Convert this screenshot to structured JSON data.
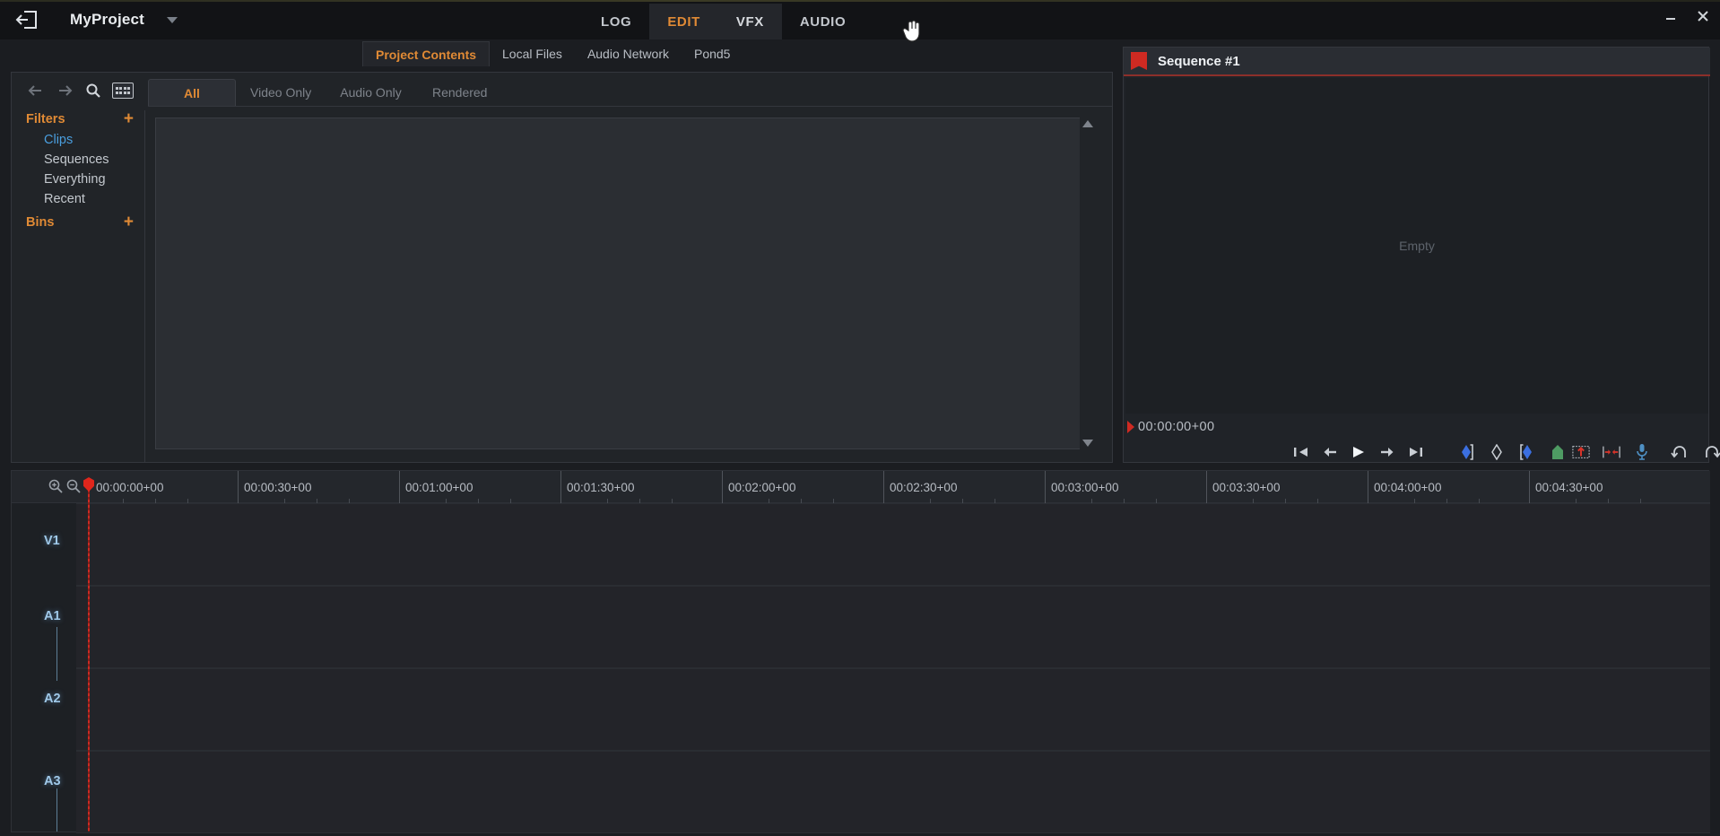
{
  "titlebar": {
    "exit_icon": "exit-icon",
    "project_name": "MyProject",
    "project_caret_icon": "chevron-down-icon",
    "mode_tabs": [
      {
        "label": "LOG",
        "active": false
      },
      {
        "label": "EDIT",
        "active": true
      },
      {
        "label": "VFX",
        "active": false,
        "hovered": true
      },
      {
        "label": "AUDIO",
        "active": false
      }
    ],
    "minimize_icon": "minimize-icon",
    "close_icon": "close-icon"
  },
  "browser": {
    "tabs": [
      {
        "label": "Project Contents",
        "active": true
      },
      {
        "label": "Local Files",
        "active": false
      },
      {
        "label": "Audio Network",
        "active": false
      },
      {
        "label": "Pond5",
        "active": false
      }
    ],
    "toolbar": {
      "back_icon": "back-arrow-icon",
      "forward_icon": "forward-arrow-icon",
      "search_icon": "search-icon",
      "view_toggle_icon": "grid-view-icon"
    },
    "filters": {
      "groups": [
        {
          "label": "Filters",
          "add_label": "+",
          "items": [
            {
              "label": "Clips",
              "selected": true
            },
            {
              "label": "Sequences",
              "selected": false
            },
            {
              "label": "Everything",
              "selected": false
            },
            {
              "label": "Recent",
              "selected": false
            }
          ]
        },
        {
          "label": "Bins",
          "add_label": "+",
          "items": []
        }
      ]
    },
    "content_tabs": [
      {
        "label": "All",
        "active": true
      },
      {
        "label": "Video Only",
        "active": false
      },
      {
        "label": "Audio Only",
        "active": false
      },
      {
        "label": "Rendered",
        "active": false
      }
    ],
    "scroll_up_icon": "scroll-up-arrow-icon",
    "scroll_down_icon": "scroll-down-arrow-icon"
  },
  "viewer": {
    "flag_icon": "sequence-flag-icon",
    "title": "Sequence #1",
    "empty_label": "Empty",
    "timecode": "00:00:00+00",
    "transport": [
      {
        "name": "go-to-start-icon",
        "label": "Go To Start"
      },
      {
        "name": "step-back-icon",
        "label": "Step Back"
      },
      {
        "name": "play-icon",
        "label": "Play"
      },
      {
        "name": "step-forward-icon",
        "label": "Step Forward"
      },
      {
        "name": "go-to-end-icon",
        "label": "Go To End"
      },
      {
        "name": "mark-in-icon",
        "label": "Mark In"
      },
      {
        "name": "mark-clip-icon",
        "label": "Mark Clip"
      },
      {
        "name": "mark-out-icon",
        "label": "Mark Out"
      },
      {
        "name": "add-marker-icon",
        "label": "Add Marker"
      },
      {
        "name": "overwrite-icon",
        "label": "Overwrite"
      },
      {
        "name": "insert-icon",
        "label": "Insert"
      },
      {
        "name": "voice-over-icon",
        "label": "Voice Over"
      },
      {
        "name": "undo-icon",
        "label": "Undo"
      },
      {
        "name": "redo-icon",
        "label": "Redo"
      }
    ]
  },
  "timeline": {
    "zoom_in_icon": "zoom-in-icon",
    "zoom_out_icon": "zoom-out-icon",
    "playhead_timecode": "00:00:00+00",
    "ruler_marks": [
      "00:00:00+00",
      "00:00:30+00",
      "00:01:00+00",
      "00:01:30+00",
      "00:02:00+00",
      "00:02:30+00",
      "00:03:00+00",
      "00:03:30+00",
      "00:04:00+00",
      "00:04:30+00"
    ],
    "tracks": [
      {
        "label": "V1",
        "type": "video"
      },
      {
        "label": "A1",
        "type": "audio"
      },
      {
        "label": "A2",
        "type": "audio"
      },
      {
        "label": "A3",
        "type": "audio"
      }
    ]
  },
  "colors": {
    "accent_orange": "#e08a35",
    "select_blue": "#4a9ede",
    "playhead_red": "#cf2a22",
    "track_label_blue": "#9fc8e8",
    "panel_bg": "#212428",
    "window_bg": "#1b1d21"
  }
}
